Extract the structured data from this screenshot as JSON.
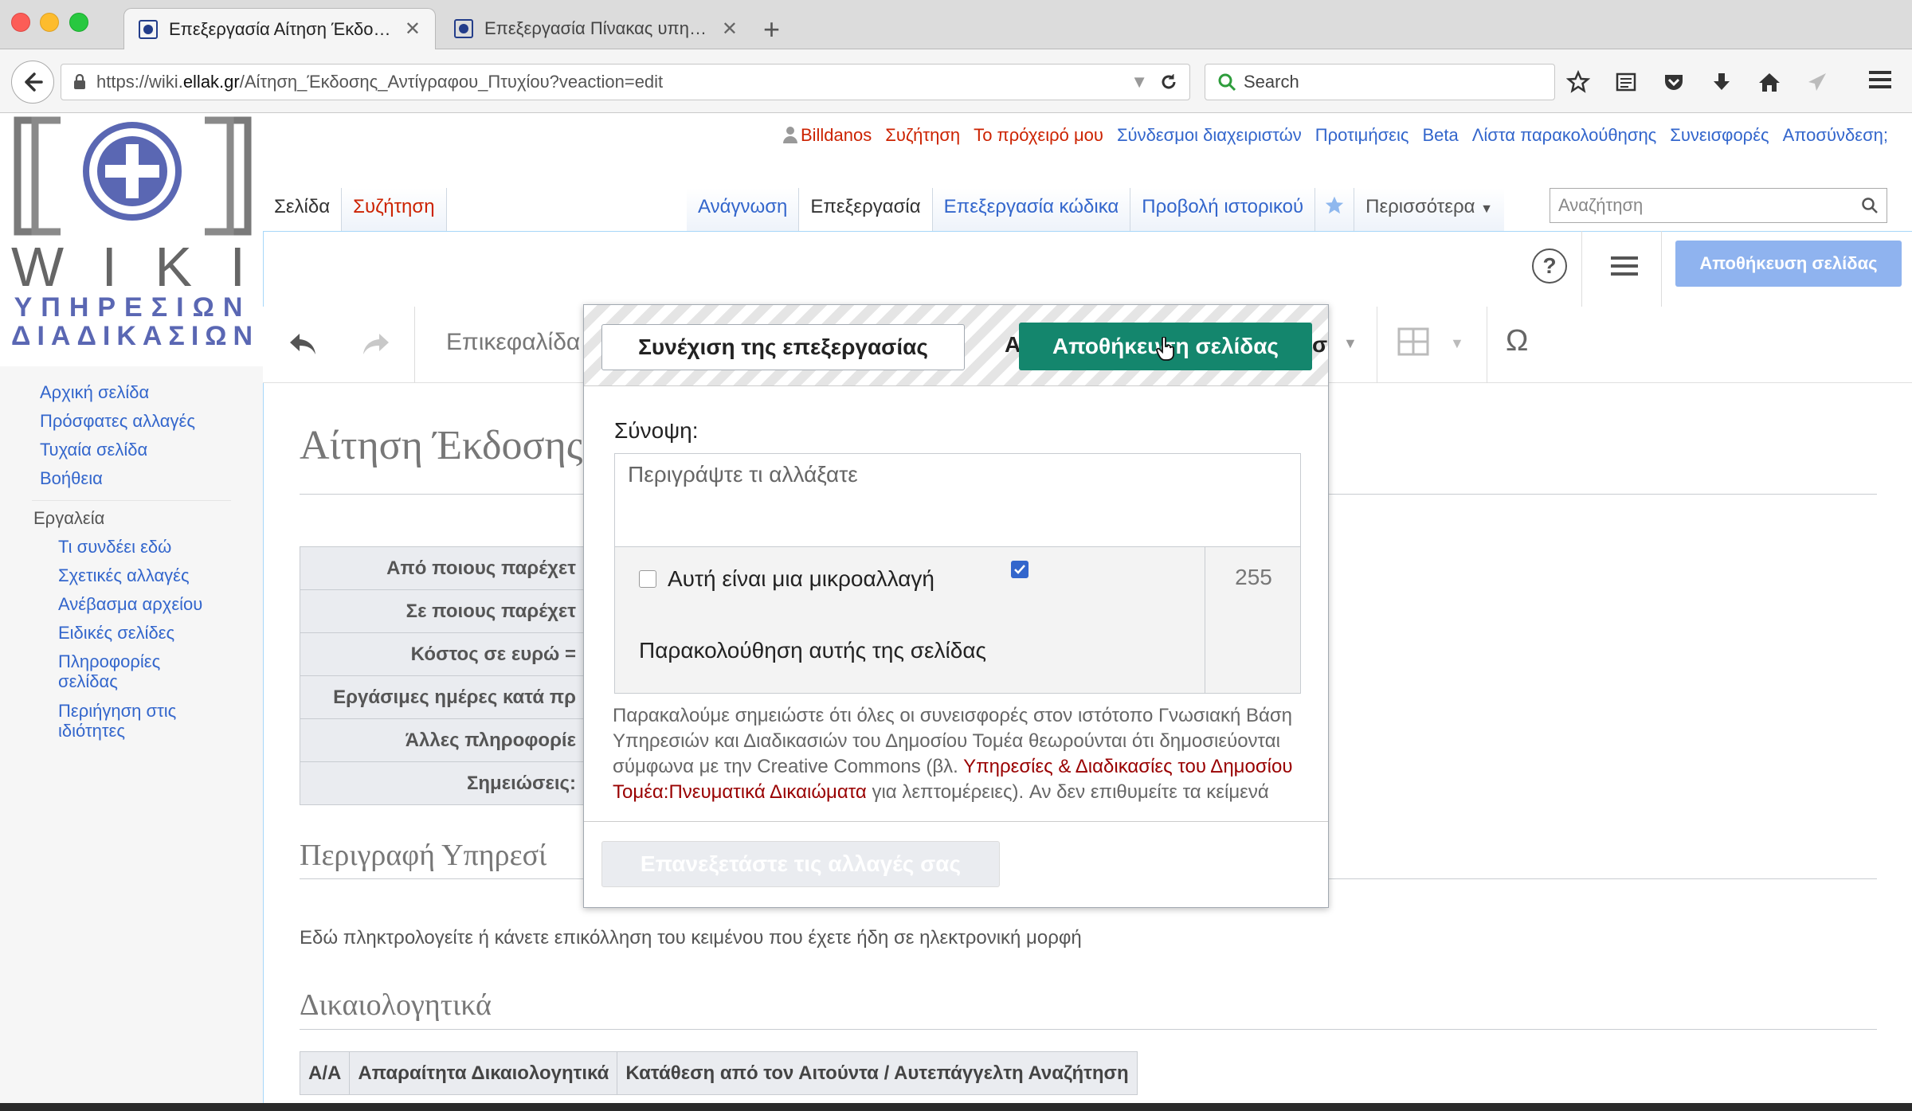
{
  "browser": {
    "tabs": [
      {
        "title": "Επεξεργασία Αίτηση Έκδοσ...",
        "active": true
      },
      {
        "title": "Επεξεργασία Πίνακας υπηρε...",
        "active": false
      }
    ],
    "url_prefix": "https://wiki.",
    "url_domain": "ellak.gr",
    "url_path": "/Αίτηση_Έκδοσης_Αντίγραφου_Πτυχίου?veaction=edit",
    "search_placeholder": "Search"
  },
  "logo": {
    "wiki": "W I K I",
    "line1": "ΥΠΗΡΕΣΙΩΝ",
    "line2": "ΔΙΑΔΙΚΑΣΙΩΝ"
  },
  "personal": {
    "user": "Billdanos",
    "items": [
      "Συζήτηση",
      "Το πρόχειρό μου",
      "Σύνδεσμοι διαχειριστών",
      "Προτιμήσεις",
      "Beta",
      "Λίστα παρακολούθησης",
      "Συνεισφορές",
      "Αποσύνδεση;"
    ]
  },
  "tabs": {
    "page": "Σελίδα",
    "talk": "Συζήτηση",
    "read": "Ανάγνωση",
    "edit": "Επεξεργασία",
    "edit_source": "Επεξεργασία κώδικα",
    "history": "Προβολή ιστορικού",
    "more": "Περισσότερα",
    "search_placeholder": "Αναζήτηση"
  },
  "sidebar": {
    "nav": [
      "Αρχική σελίδα",
      "Πρόσφατες αλλαγές",
      "Τυχαία σελίδα",
      "Βοήθεια"
    ],
    "tools_heading": "Εργαλεία",
    "tools": [
      "Τι συνδέει εδώ",
      "Σχετικές αλλαγές",
      "Ανέβασμα αρχείου",
      "Ειδικές σελίδες",
      "Πληροφορίες σελίδας",
      "Περιήγηση στις ιδιότητες"
    ]
  },
  "editor": {
    "save_page": "Αποθήκευση σελίδας",
    "heading_dropdown": "Επικεφαλίδα"
  },
  "article": {
    "title": "Αίτηση Έκδοσης",
    "info_rows": [
      "Από ποιους παρέχετ",
      "Σε ποιους παρέχετ",
      "Κόστος σε ευρώ =",
      "Εργάσιμες ημέρες κατά πρ",
      "Άλλες πληροφορίε",
      "Σημειώσεις:"
    ],
    "section1": "Περιγραφή Υπηρεσί",
    "section1_text": "Εδώ πληκτρολογείτε ή κάνετε επικόλληση του κειμένου που έχετε ήδη σε ηλεκτρονική μορφή",
    "section2": "Δικαιολογητικά",
    "table_headers": [
      "Α/Α",
      "Απαραίτητα Δικαιολογητικά",
      "Κατάθεση από τον Αιτούντα / Αυτεπάγγελτη Αναζήτηση"
    ]
  },
  "dialog": {
    "continue": "Συνέχιση της επεξεργασίας",
    "save": "Αποθήκευση σελίδας",
    "summary_label": "Σύνοψη:",
    "summary_placeholder": "Περιγράψτε τι αλλάξατε",
    "minor_edit": "Αυτή είναι μια μικροαλλαγή",
    "watch_page": "Παρακολούθηση αυτής της σελίδας",
    "char_count": "255",
    "license_text_1": "Παρακαλούμε σημειώστε ότι όλες οι συνεισφορές στον ιστότοπο Γνωσιακή Βάση Υπηρεσιών και Διαδικασιών του Δημοσίου Τομέα θεωρούνται ότι δημοσιεύονται σύμφωνα με την Creative Commons (βλ. ",
    "license_link": "Υπηρεσίες & Διαδικασίες του Δημοσίου Τομέα:Πνευματικά Δικαιώματα",
    "license_text_2": " για λεπτομέρειες). Αν δεν επιθυμείτε τα κείμενά σας να",
    "review": "Επανεξετάστε τις αλλαγές σας"
  },
  "colors": {
    "save_green": "#14866d",
    "link_blue": "#3366cc",
    "new_link_red": "#cc2200",
    "save_blue_disabled": "#8fb3ef"
  }
}
